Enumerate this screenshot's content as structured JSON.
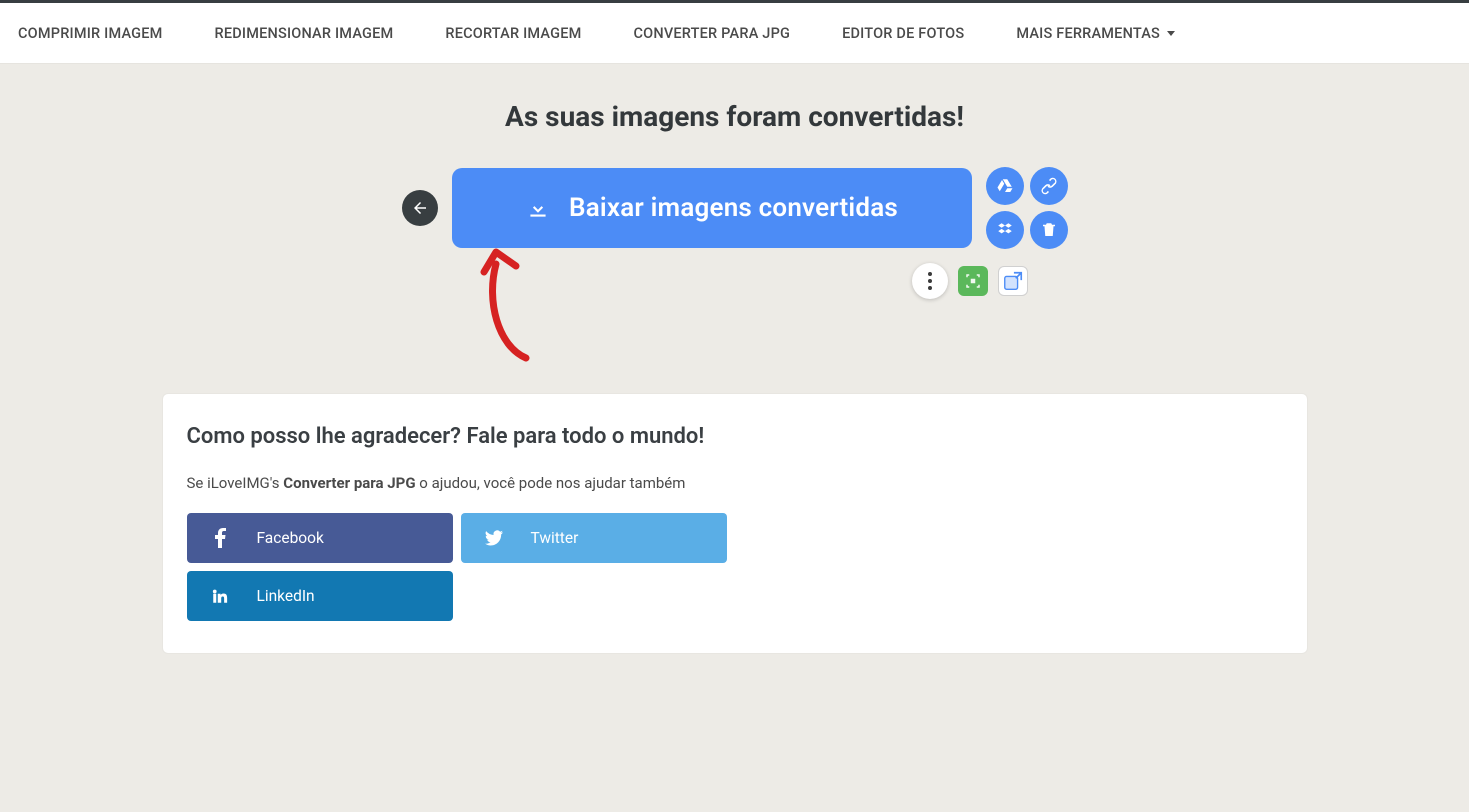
{
  "nav": {
    "items": [
      "COMPRIMIR IMAGEM",
      "REDIMENSIONAR IMAGEM",
      "RECORTAR IMAGEM",
      "CONVERTER PARA JPG",
      "EDITOR DE FOTOS",
      "MAIS FERRAMENTAS"
    ]
  },
  "headline": "As suas imagens foram convertidas!",
  "download": {
    "label": "Baixar imagens convertidas"
  },
  "share_card": {
    "title": "Como posso lhe agradecer? Fale para todo o mundo!",
    "sub_pre": "Se iLoveIMG's ",
    "sub_bold": "Converter para JPG",
    "sub_post": " o ajudou, você pode nos ajudar também",
    "buttons": {
      "facebook": "Facebook",
      "twitter": "Twitter",
      "linkedin": "LinkedIn"
    }
  }
}
